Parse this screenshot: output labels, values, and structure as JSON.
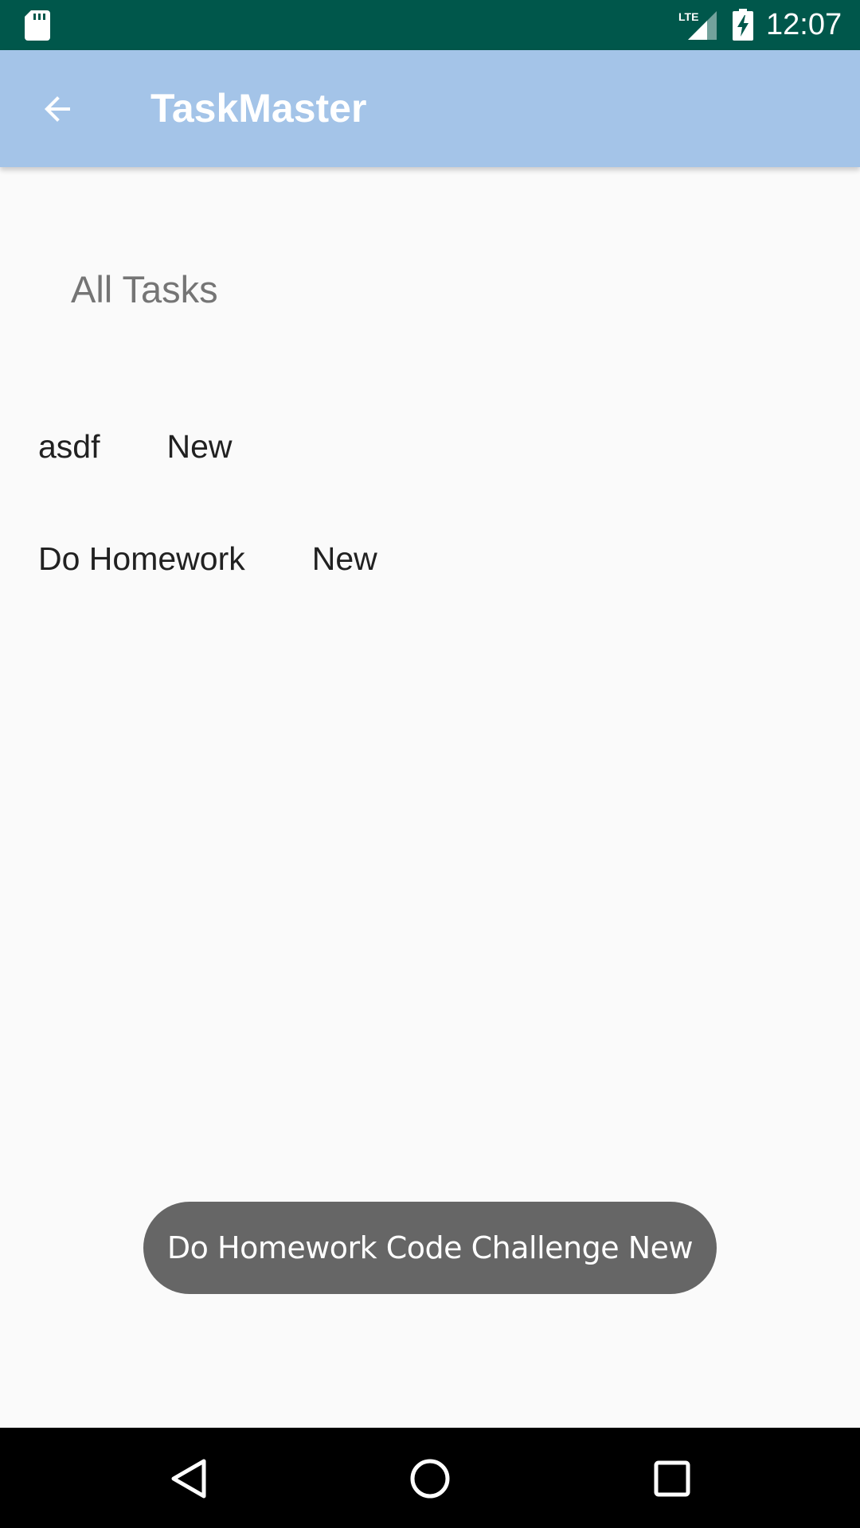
{
  "status_bar": {
    "time": "12:07",
    "network_label": "LTE",
    "icons": [
      "sd-card-icon",
      "lte-signal-icon",
      "battery-charging-icon"
    ]
  },
  "app_bar": {
    "title": "TaskMaster",
    "back_icon": "arrow-back-icon"
  },
  "main": {
    "section_title": "All Tasks",
    "tasks": [
      {
        "name": "asdf",
        "status": "New"
      },
      {
        "name": "Do Homework",
        "status": "New"
      }
    ]
  },
  "toast": {
    "text": "Do Homework Code Challenge New"
  },
  "nav_bar": {
    "icons": [
      "nav-back-icon",
      "nav-home-icon",
      "nav-recents-icon"
    ]
  },
  "colors": {
    "status_bar": "#00574b",
    "app_bar": "#a4c4e8",
    "background": "#fafafa",
    "toast": "#666666",
    "nav_bar": "#000000"
  }
}
